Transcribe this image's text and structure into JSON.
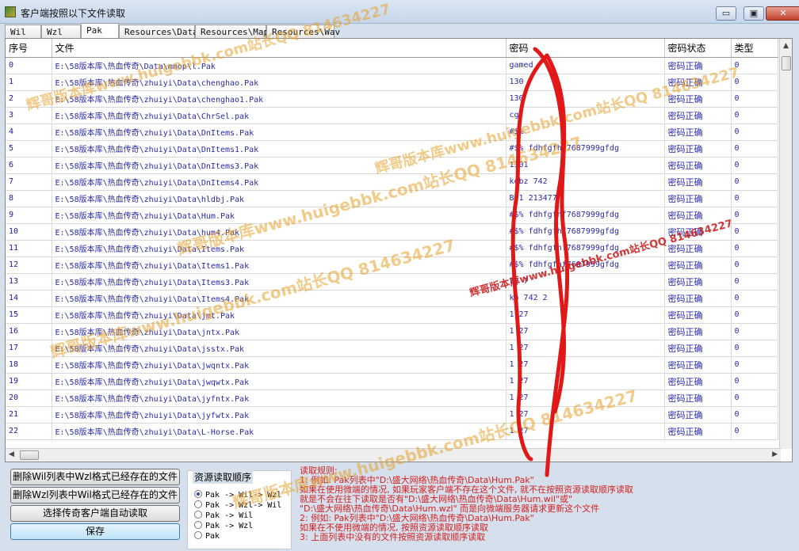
{
  "window": {
    "title": "客户端按照以下文件读取",
    "minimize": "▭",
    "maximize": "▣",
    "close": "✕"
  },
  "tabs": [
    "Wil",
    "Wzl",
    "Pak",
    "Resources\\Data",
    "Resources\\Map",
    "Resources\\Wav"
  ],
  "active_tab": "Pak",
  "table": {
    "headers": [
      "序号",
      "文件",
      "密码",
      "密码状态",
      "类型"
    ],
    "rows": [
      [
        "0",
        "E:\\58版本库\\热血传奇\\Data\\mmop\\l.Pak",
        "gamed",
        "密码正确",
        "0"
      ],
      [
        "1",
        "E:\\58版本库\\热血传奇\\zhuiyi\\Data\\chenghao.Pak",
        "130",
        "密码正确",
        "0"
      ],
      [
        "2",
        "E:\\58版本库\\热血传奇\\zhuiyi\\Data\\chenghao1.Pak",
        "130",
        "密码正确",
        "0"
      ],
      [
        "3",
        "E:\\58版本库\\热血传奇\\zhuiyi\\Data\\ChrSel.pak",
        "cgf",
        "密码正确",
        "0"
      ],
      [
        "4",
        "E:\\58版本库\\热血传奇\\zhuiyi\\Data\\DnItems.Pak",
        "#$%",
        "密码正确",
        "0"
      ],
      [
        "5",
        "E:\\58版本库\\热血传奇\\zhuiyi\\Data\\DnItems1.Pak",
        "#$%  fdhfgfhf7687999gfdg",
        "密码正确",
        "0"
      ],
      [
        "6",
        "E:\\58版本库\\热血传奇\\zhuiyi\\Data\\DnItems3.Pak",
        "1301",
        "密码正确",
        "0"
      ],
      [
        "7",
        "E:\\58版本库\\热血传奇\\zhuiyi\\Data\\DnItems4.Pak",
        "kobz  742",
        "密码正确",
        "0"
      ],
      [
        "8",
        "E:\\58版本库\\热血传奇\\zhuiyi\\Data\\hldbj.Pak",
        "Bi1  213477",
        "密码正确",
        "0"
      ],
      [
        "9",
        "E:\\58版本库\\热血传奇\\zhuiyi\\Data\\Hum.Pak",
        "#$%  fdhfgfhf7687999gfdg",
        "密码正确",
        "0"
      ],
      [
        "10",
        "E:\\58版本库\\热血传奇\\zhuiyi\\Data\\hum4.Pak",
        "#$%  fdhfgfhf7687999gfdg",
        "密码正确",
        "0"
      ],
      [
        "11",
        "E:\\58版本库\\热血传奇\\zhuiyi\\Data\\Items.Pak",
        "#$%  fdhfgfhf7687999gfdg",
        "密码正确",
        "0"
      ],
      [
        "12",
        "E:\\58版本库\\热血传奇\\zhuiyi\\Data\\Items1.Pak",
        "#$%  fdhfgfhf7687999gfdg",
        "密码正确",
        "0"
      ],
      [
        "13",
        "E:\\58版本库\\热血传奇\\zhuiyi\\Data\\Items3.Pak",
        "13  7",
        "密码正确",
        "0"
      ],
      [
        "14",
        "E:\\58版本库\\热血传奇\\zhuiyi\\Data\\Items4.Pak",
        "ko  742  2",
        "密码正确",
        "0"
      ],
      [
        "15",
        "E:\\58版本库\\热血传奇\\zhuiyi\\Data\\jmt.Pak",
        "1  27",
        "密码正确",
        "0"
      ],
      [
        "16",
        "E:\\58版本库\\热血传奇\\zhuiyi\\Data\\jntx.Pak",
        "1  27",
        "密码正确",
        "0"
      ],
      [
        "17",
        "E:\\58版本库\\热血传奇\\zhuiyi\\Data\\jsstx.Pak",
        "1  27",
        "密码正确",
        "0"
      ],
      [
        "18",
        "E:\\58版本库\\热血传奇\\zhuiyi\\Data\\jwqntx.Pak",
        "1  27",
        "密码正确",
        "0"
      ],
      [
        "19",
        "E:\\58版本库\\热血传奇\\zhuiyi\\Data\\jwqwtx.Pak",
        "1  27",
        "密码正确",
        "0"
      ],
      [
        "20",
        "E:\\58版本库\\热血传奇\\zhuiyi\\Data\\jyfntx.Pak",
        "1  27",
        "密码正确",
        "0"
      ],
      [
        "21",
        "E:\\58版本库\\热血传奇\\zhuiyi\\Data\\jyfwtx.Pak",
        "1  27",
        "密码正确",
        "0"
      ],
      [
        "22",
        "E:\\58版本库\\热血传奇\\zhuiyi\\Data\\L-Horse.Pak",
        "1  27",
        "密码正确",
        "0"
      ]
    ]
  },
  "buttons": {
    "delete_wil": "删除Wil列表中Wzl格式已经存在的文件",
    "delete_wzl": "删除Wzl列表中Wil格式已经存在的文件",
    "auto_read": "选择传奇客户端自动读取",
    "save": "保存"
  },
  "resource_order": {
    "title": "资源读取顺序",
    "options": [
      "Pak -> Wil-> Wzl",
      "Pak -> Wzl-> Wil",
      "Pak -> Wil",
      "Pak -> Wzl",
      "Pak"
    ],
    "selected": 0
  },
  "rules": {
    "title": "读取规则:",
    "lines": [
      "1: 例如: Pak列表中\"D:\\盛大网络\\热血传奇\\Data\\Hum.Pak\"",
      "    如果在使用微端的情况, 如果玩家客户端不存在这个文件, 就不在按照资源读取顺序读取",
      "    就是不会在往下读取是否有\"D:\\盛大网络\\热血传奇\\Data\\Hum.wil\"或\"",
      "    \"D:\\盛大网络\\热血传奇\\Data\\Hum.wzl\" 而是向微端服务器请求更新这个文件",
      "2: 例如: Pak列表中\"D:\\盛大网络\\热血传奇\\Data\\Hum.Pak\"",
      "    如果在不使用微端的情况, 按照资源读取顺序读取",
      "3: 上面列表中没有的文件按照资源读取顺序读取"
    ]
  },
  "watermarks": {
    "a": "辉哥版本库www.huigebbk.com站长QQ 814634227",
    "b": "辉哥版本库www.huigebbk.com站长QQ 814634227",
    "c": "辉哥版本库www.huigebbk.com站长QQ 814634227",
    "d": "辉哥版本库www.huigebbk.com站长QQ 814634227",
    "e": "辉哥版本库www.huigebbk.com站长QQ 814634227",
    "f": "辉哥版本库www.huigebbk.com站长QQ 814634227"
  },
  "colors": {
    "rules_text": "#d42020",
    "table_text": "#2a2aa8",
    "scribble": "#e01818"
  }
}
